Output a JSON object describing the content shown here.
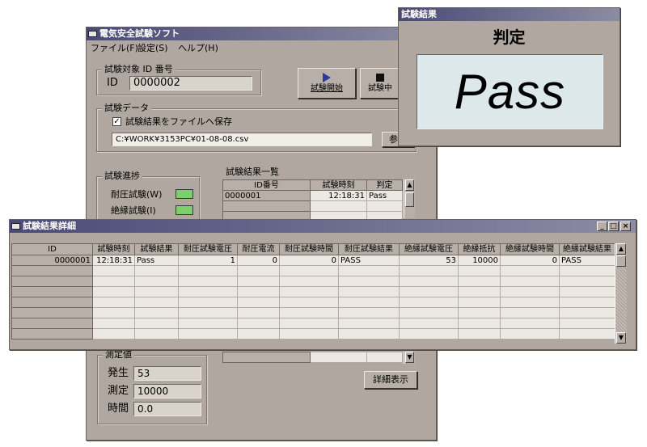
{
  "main": {
    "title": "電気安全試験ソフト",
    "menu": [
      "ファイル(F)",
      "設定(S)",
      "ヘルプ(H)"
    ],
    "target_group": "試験対象 ID 番号",
    "id_label": "ID",
    "id_value": "0000002",
    "start_button": "試験開始",
    "stop_button": "試験中",
    "data_group": "試験データ",
    "save_checkbox": "試験結果をファイルへ保存",
    "file_path": "C:¥WORK¥3153PC¥01-08-08.csv",
    "browse_button": "参照",
    "progress_group": "試験進捗",
    "progress_items": [
      "耐圧試験(W)",
      "絶縁試験(I)"
    ],
    "list_title": "試験結果一覧",
    "list_headers": [
      "ID番号",
      "試験時刻",
      "判定"
    ],
    "list_rows": [
      [
        "0000001",
        "12:18:31",
        "Pass"
      ],
      [
        "",
        "",
        ""
      ],
      [
        "",
        "",
        ""
      ],
      [
        "",
        "",
        ""
      ]
    ],
    "measure_group": "測定値",
    "measure": [
      {
        "label": "発生",
        "value": "53"
      },
      {
        "label": "測定",
        "value": "10000"
      },
      {
        "label": "時間",
        "value": "0.0"
      }
    ],
    "detail_button": "詳細表示"
  },
  "result": {
    "title": "試験結果",
    "heading": "判定",
    "value": "Pass"
  },
  "detail": {
    "title": "試験結果詳細",
    "headers": [
      "ID",
      "試験時刻",
      "試験結果",
      "耐圧試験電圧",
      "耐圧電流",
      "耐圧試験時間",
      "耐圧試験結果",
      "絶縁試験電圧",
      "絶縁抵抗",
      "絶縁試験時間",
      "絶縁試験結果"
    ],
    "rows": [
      [
        "0000001",
        "12:18:31",
        "Pass",
        "1",
        "0",
        "0",
        "PASS",
        "53",
        "10000",
        "0",
        "PASS"
      ],
      [
        "",
        "",
        "",
        "",
        "",
        "",
        "",
        "",
        "",
        "",
        ""
      ],
      [
        "",
        "",
        "",
        "",
        "",
        "",
        "",
        "",
        "",
        "",
        ""
      ],
      [
        "",
        "",
        "",
        "",
        "",
        "",
        "",
        "",
        "",
        "",
        ""
      ],
      [
        "",
        "",
        "",
        "",
        "",
        "",
        "",
        "",
        "",
        "",
        ""
      ],
      [
        "",
        "",
        "",
        "",
        "",
        "",
        "",
        "",
        "",
        "",
        ""
      ],
      [
        "",
        "",
        "",
        "",
        "",
        "",
        "",
        "",
        "",
        "",
        ""
      ],
      [
        "",
        "",
        "",
        "",
        "",
        "",
        "",
        "",
        "",
        "",
        ""
      ]
    ],
    "controls": [
      "_",
      "□",
      "×"
    ]
  },
  "colors": {
    "window_bg": "#b0a8a0",
    "title_bar": "#4a4a78",
    "led_on": "#7ccf6c",
    "result_panel": "#dde8ea"
  }
}
